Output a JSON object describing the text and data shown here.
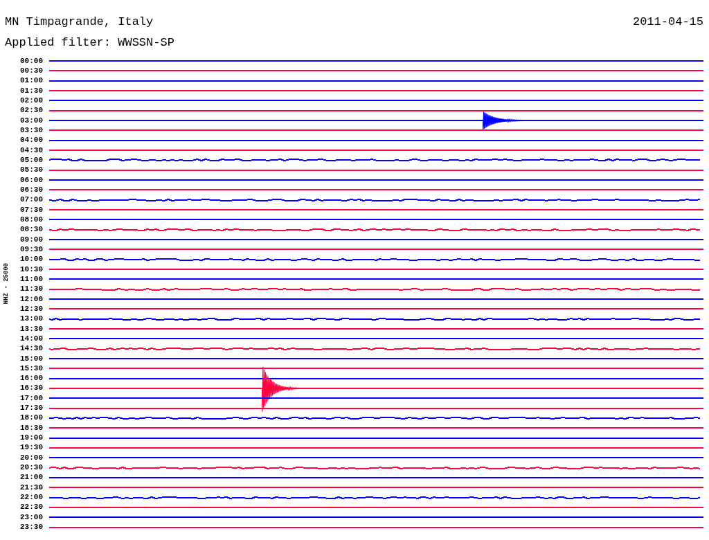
{
  "header": {
    "title": "MN Timpagrande, Italy",
    "date": "2011-04-15",
    "filter": "Applied filter: WWSSN-SP"
  },
  "axis_label": "HHZ - 25000",
  "traces": [
    {
      "time": "00:00",
      "color": "#0000ff",
      "kind": "quiet"
    },
    {
      "time": "00:30",
      "color": "#ff0040",
      "kind": "quiet"
    },
    {
      "time": "01:00",
      "color": "#0000ff",
      "kind": "quiet"
    },
    {
      "time": "01:30",
      "color": "#ff0040",
      "kind": "quiet"
    },
    {
      "time": "02:00",
      "color": "#0000ff",
      "kind": "quiet"
    },
    {
      "time": "02:30",
      "color": "#ff0040",
      "kind": "quiet"
    },
    {
      "time": "03:00",
      "color": "#0000ff",
      "kind": "event"
    },
    {
      "time": "03:30",
      "color": "#ff0040",
      "kind": "quiet"
    },
    {
      "time": "04:00",
      "color": "#0000ff",
      "kind": "quiet"
    },
    {
      "time": "04:30",
      "color": "#ff0040",
      "kind": "quiet"
    },
    {
      "time": "05:00",
      "color": "#0000ff",
      "kind": "noisy"
    },
    {
      "time": "05:30",
      "color": "#ff0040",
      "kind": "quiet"
    },
    {
      "time": "06:00",
      "color": "#0000ff",
      "kind": "quiet"
    },
    {
      "time": "06:30",
      "color": "#ff0040",
      "kind": "quiet"
    },
    {
      "time": "07:00",
      "color": "#0000ff",
      "kind": "noisy"
    },
    {
      "time": "07:30",
      "color": "#ff0040",
      "kind": "quiet"
    },
    {
      "time": "08:00",
      "color": "#0000ff",
      "kind": "quiet"
    },
    {
      "time": "08:30",
      "color": "#ff0040",
      "kind": "noisy"
    },
    {
      "time": "09:00",
      "color": "#0000ff",
      "kind": "quiet"
    },
    {
      "time": "09:30",
      "color": "#ff0040",
      "kind": "quiet"
    },
    {
      "time": "10:00",
      "color": "#0000ff",
      "kind": "noisy"
    },
    {
      "time": "10:30",
      "color": "#ff0040",
      "kind": "quiet"
    },
    {
      "time": "11:00",
      "color": "#0000ff",
      "kind": "quiet"
    },
    {
      "time": "11:30",
      "color": "#ff0040",
      "kind": "noisy"
    },
    {
      "time": "12:00",
      "color": "#0000ff",
      "kind": "quiet"
    },
    {
      "time": "12:30",
      "color": "#ff0040",
      "kind": "quiet"
    },
    {
      "time": "13:00",
      "color": "#0000ff",
      "kind": "noisy"
    },
    {
      "time": "13:30",
      "color": "#ff0040",
      "kind": "quiet"
    },
    {
      "time": "14:00",
      "color": "#0000ff",
      "kind": "quiet"
    },
    {
      "time": "14:30",
      "color": "#ff0040",
      "kind": "noisy"
    },
    {
      "time": "15:00",
      "color": "#0000ff",
      "kind": "quiet"
    },
    {
      "time": "15:30",
      "color": "#ff0040",
      "kind": "quiet"
    },
    {
      "time": "16:00",
      "color": "#0000ff",
      "kind": "quiet"
    },
    {
      "time": "16:30",
      "color": "#ff0040",
      "kind": "event"
    },
    {
      "time": "17:00",
      "color": "#0000ff",
      "kind": "quiet"
    },
    {
      "time": "17:30",
      "color": "#ff0040",
      "kind": "quiet"
    },
    {
      "time": "18:00",
      "color": "#0000ff",
      "kind": "noisy"
    },
    {
      "time": "18:30",
      "color": "#ff0040",
      "kind": "quiet"
    },
    {
      "time": "19:00",
      "color": "#0000ff",
      "kind": "quiet"
    },
    {
      "time": "19:30",
      "color": "#ff0040",
      "kind": "quiet"
    },
    {
      "time": "20:00",
      "color": "#0000ff",
      "kind": "quiet"
    },
    {
      "time": "20:30",
      "color": "#ff0040",
      "kind": "noisy"
    },
    {
      "time": "21:00",
      "color": "#0000ff",
      "kind": "quiet"
    },
    {
      "time": "21:30",
      "color": "#ff0040",
      "kind": "quiet"
    },
    {
      "time": "22:00",
      "color": "#0000ff",
      "kind": "noisy"
    },
    {
      "time": "22:30",
      "color": "#ff0040",
      "kind": "quiet"
    },
    {
      "time": "23:00",
      "color": "#0000ff",
      "kind": "quiet"
    },
    {
      "time": "23:30",
      "color": "#ff0040",
      "kind": "quiet"
    }
  ]
}
